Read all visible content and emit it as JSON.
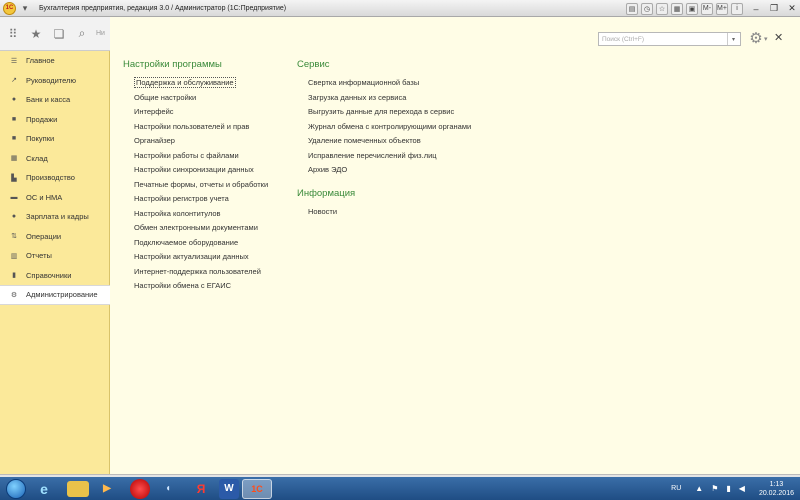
{
  "window": {
    "title": "Бухгалтерия предприятия, редакция 3.0 / Администратор  (1С:Предприятие)"
  },
  "toolstrip": {
    "search_stub": "Ни"
  },
  "sidebar": {
    "items": [
      {
        "label": "Главное",
        "icon": "list-icon"
      },
      {
        "label": "Руководителю",
        "icon": "trend-icon"
      },
      {
        "label": "Банк и касса",
        "icon": "coin-icon"
      },
      {
        "label": "Продажи",
        "icon": "bag-icon"
      },
      {
        "label": "Покупки",
        "icon": "cart-icon"
      },
      {
        "label": "Склад",
        "icon": "warehouse-icon"
      },
      {
        "label": "Производство",
        "icon": "factory-icon"
      },
      {
        "label": "ОС и НМА",
        "icon": "truck-icon"
      },
      {
        "label": "Зарплата и кадры",
        "icon": "person-icon"
      },
      {
        "label": "Операции",
        "icon": "operations-icon"
      },
      {
        "label": "Отчеты",
        "icon": "report-icon"
      },
      {
        "label": "Справочники",
        "icon": "book-icon"
      },
      {
        "label": "Администрирование",
        "icon": "gear-icon",
        "active": true
      }
    ]
  },
  "search": {
    "placeholder": "Поиск (Ctrl+F)"
  },
  "groups": {
    "settings": {
      "title": "Настройки программы",
      "links": [
        "Поддержка и обслуживание",
        "Общие настройки",
        "Интерфейс",
        "Настройки пользователей и прав",
        "Органайзер",
        "Настройки работы с файлами",
        "Настройки синхронизации данных",
        "Печатные формы, отчеты и обработки",
        "Настройки регистров учета",
        "Настройка колонтитулов",
        "Обмен электронными документами",
        "Подключаемое оборудование",
        "Настройки актуализации данных",
        "Интернет-поддержка пользователей",
        "Настройки обмена с ЕГАИС"
      ]
    },
    "service": {
      "title": "Сервис",
      "links": [
        "Свертка информационной базы",
        "Загрузка данных из сервиса",
        "Выгрузить данные для перехода в сервис",
        "Журнал обмена с контролирующими органами",
        "Удаление помеченных объектов",
        "Исправление перечислений физ.лиц",
        "Архив ЭДО"
      ]
    },
    "info": {
      "title": "Информация",
      "links": [
        "Новости"
      ]
    }
  },
  "taskbar": {
    "lang": "RU",
    "time": "1:13",
    "date": "20.02.2016"
  }
}
